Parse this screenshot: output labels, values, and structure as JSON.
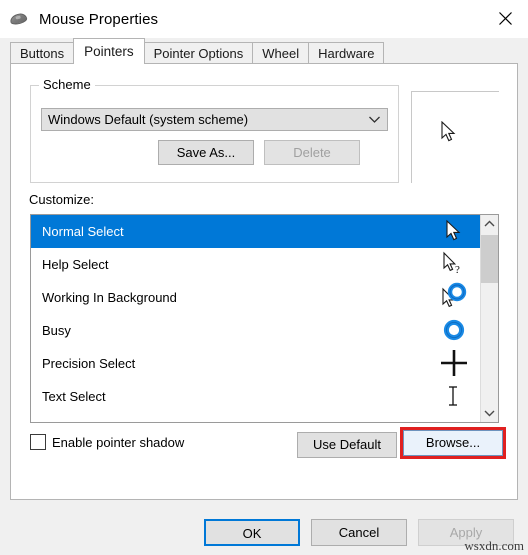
{
  "window": {
    "title": "Mouse Properties",
    "icon": "mouse-icon",
    "close_label": "✕"
  },
  "tabs": [
    {
      "label": "Buttons",
      "active": false
    },
    {
      "label": "Pointers",
      "active": true
    },
    {
      "label": "Pointer Options",
      "active": false
    },
    {
      "label": "Wheel",
      "active": false
    },
    {
      "label": "Hardware",
      "active": false
    }
  ],
  "scheme": {
    "group_label": "Scheme",
    "combo_value": "Windows Default (system scheme)",
    "combo_icon": "chevron-down-icon",
    "save_as_label": "Save As...",
    "delete_label": "Delete",
    "delete_disabled": true
  },
  "preview": {
    "cursor": "arrow-pointer-cursor"
  },
  "customize": {
    "label": "Customize:",
    "selected_index": 0,
    "items": [
      {
        "label": "Normal Select",
        "icon": "arrow-pointer-cursor"
      },
      {
        "label": "Help Select",
        "icon": "arrow-question-cursor"
      },
      {
        "label": "Working In Background",
        "icon": "arrow-busy-ring-cursor"
      },
      {
        "label": "Busy",
        "icon": "busy-ring-cursor"
      },
      {
        "label": "Precision Select",
        "icon": "crosshair-cursor"
      },
      {
        "label": "Text Select",
        "icon": "i-beam-cursor"
      }
    ],
    "scrollbar": {
      "up_icon": "chevron-up-icon",
      "down_icon": "chevron-down-icon"
    }
  },
  "options": {
    "shadow_label": "Enable pointer shadow",
    "shadow_checked": false,
    "use_default_label": "Use Default",
    "browse_label": "Browse...",
    "browse_highlight_color": "#e02020"
  },
  "footer": {
    "ok_label": "OK",
    "cancel_label": "Cancel",
    "apply_label": "Apply",
    "apply_disabled": true
  },
  "watermark": "wsxdn.com",
  "colors": {
    "selection_blue": "#0078d7",
    "dialog_bg": "#f0f0f0",
    "panel_bg": "#ffffff",
    "busy_ring": "#1a8ae5"
  }
}
